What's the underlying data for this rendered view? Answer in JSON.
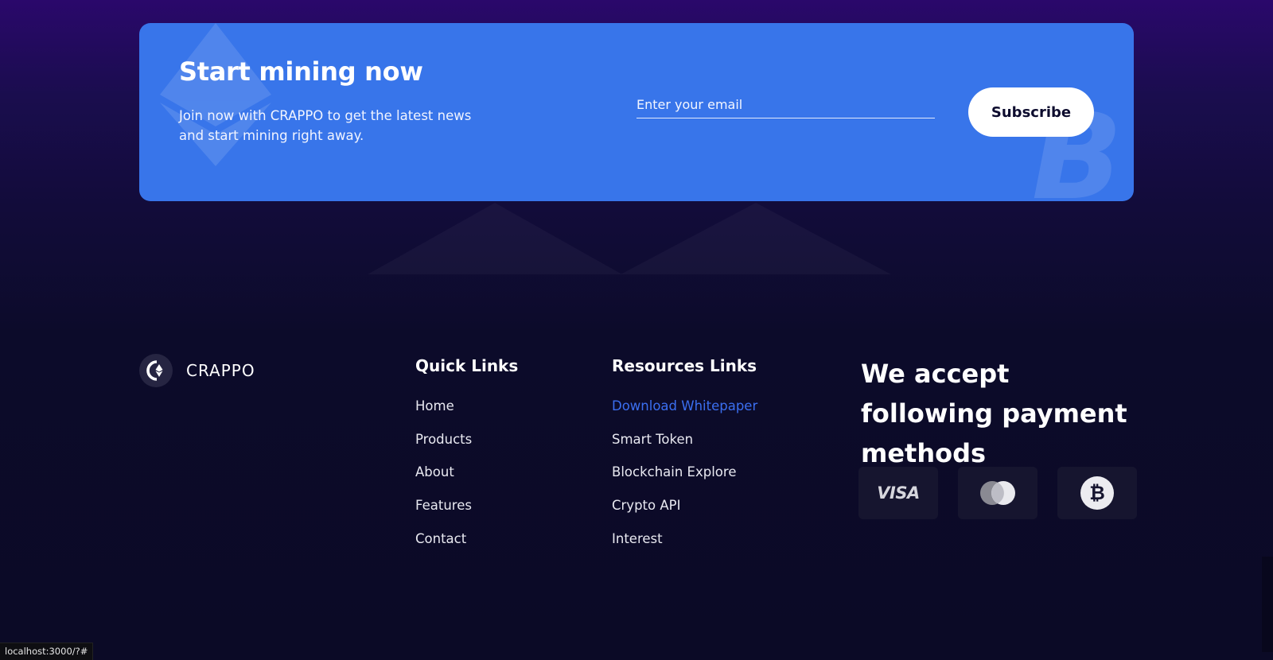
{
  "cta": {
    "title": "Start mining now",
    "description": "Join now with CRAPPO to get the latest news and start mining right away.",
    "email_placeholder": "Enter your email",
    "subscribe_label": "Subscribe"
  },
  "brand": {
    "name": "CRAPPO",
    "logo_icon": "crappo-logo-icon"
  },
  "quick_links": {
    "title": "Quick Links",
    "items": [
      "Home",
      "Products",
      "About",
      "Features",
      "Contact"
    ]
  },
  "resources_links": {
    "title": "Resources Links",
    "items": [
      "Download Whitepaper",
      "Smart Token",
      "Blockchain Explore",
      "Crypto API",
      "Interest"
    ],
    "active_color": "#3b6ff0"
  },
  "payment": {
    "title": "We accept following payment methods",
    "methods": [
      {
        "name": "VISA",
        "icon": "visa-icon"
      },
      {
        "name": "Mastercard",
        "icon": "mastercard-icon"
      },
      {
        "name": "Bitcoin",
        "icon": "bitcoin-icon"
      }
    ]
  },
  "status_bar": {
    "url": "localhost:3000/?#"
  },
  "colors": {
    "cta_background": "#3875ea",
    "page_background": "#0b0a26",
    "accent": "#3b6ff0"
  }
}
